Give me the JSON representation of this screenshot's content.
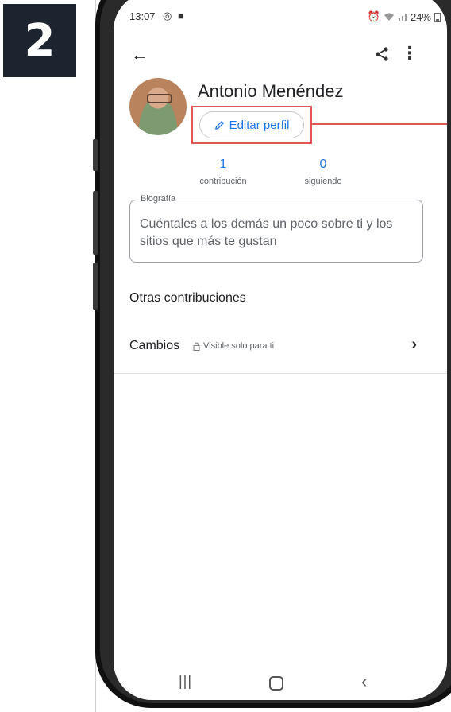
{
  "step": {
    "number": "2"
  },
  "status_bar": {
    "time": "13:07",
    "left_icons": "◎ ■",
    "battery": "24%"
  },
  "top_bar": {
    "back_icon": "arrow-left-icon",
    "share_icon": "share-icon",
    "more_icon": "more-vert-icon"
  },
  "profile": {
    "name": "Antonio Menéndez",
    "edit_button_label": "Editar perfil",
    "edit_icon": "pencil-icon"
  },
  "stats": [
    {
      "value": "1",
      "label": "contribución"
    },
    {
      "value": "0",
      "label": "siguiendo"
    }
  ],
  "bio": {
    "label": "Biografía",
    "placeholder": "Cuéntales a los demás un poco sobre ti y los sitios que más te gustan"
  },
  "section": {
    "title": "Otras contribuciones"
  },
  "rows": [
    {
      "label": "Cambios",
      "visibility": "Visible solo para ti",
      "lock_icon": "lock-icon",
      "chevron_icon": "chevron-right-icon"
    }
  ],
  "nav": {
    "recents": "|||",
    "home": "home-icon",
    "back": "‹"
  },
  "colors": {
    "accent": "#1a73e8",
    "highlight": "#e05555",
    "badge": "#1d2430"
  }
}
